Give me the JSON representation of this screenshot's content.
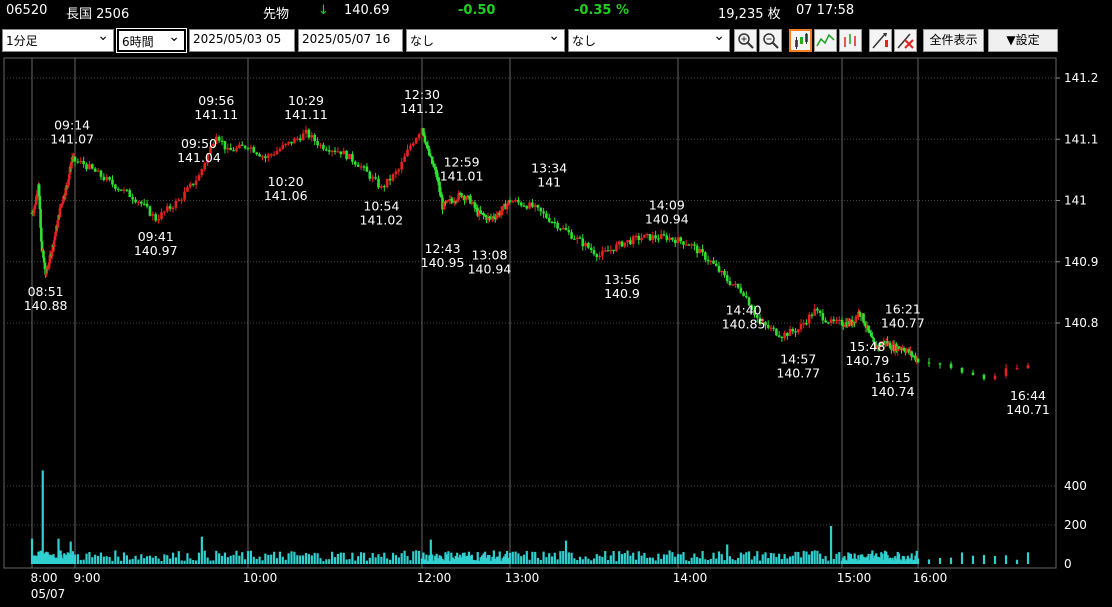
{
  "header": {
    "code": "06520",
    "name": "長国 2506",
    "type": "先物",
    "arrow": "↓",
    "price": "140.69",
    "change": "-0.50",
    "change_pct": "-0.35 %",
    "volume": "19,235 枚",
    "time": "07 17:58"
  },
  "toolbar": {
    "interval": "1分足",
    "span": "6時間",
    "from": "2025/05/03 05",
    "to": "2025/05/07 16",
    "indicator1": "なし",
    "indicator2": "なし",
    "zoom_in_icon": "zoom-in-icon",
    "zoom_out_icon": "zoom-out-icon",
    "candle_icon": "candlestick-icon",
    "line_icon": "line-chart-icon",
    "bar_icon": "ohlc-bar-icon",
    "draw_icon1": "draw-tool-icon",
    "draw_icon2": "draw-tool-erase-icon",
    "show_all": "全件表示",
    "settings": "▼設定"
  },
  "colors": {
    "up": "#e82020",
    "down": "#30e030",
    "volume": "#30d0d0",
    "grid": "#555555"
  },
  "chart_data": {
    "type": "candlestick",
    "price_axis": {
      "ticks": [
        "141.2",
        "141.1",
        "141",
        "140.9",
        "140.8"
      ],
      "ylim": [
        140.65,
        141.23
      ]
    },
    "volume_axis": {
      "ticks": [
        "400",
        "200",
        "0"
      ],
      "ylim": [
        0,
        480
      ]
    },
    "time_axis": {
      "ticks": [
        {
          "label": "8:00",
          "minute": 0
        },
        {
          "label": "9:00",
          "minute": 60
        },
        {
          "label": "10:00",
          "minute": 120
        },
        {
          "label": "12:00",
          "minute": 180
        },
        {
          "label": "13:00",
          "minute": 240
        },
        {
          "label": "14:00",
          "minute": 300
        },
        {
          "label": "15:00",
          "minute": 360
        },
        {
          "label": "16:00",
          "minute": 420
        }
      ],
      "date_label": "05/07"
    },
    "price_path": [
      [
        0,
        140.98
      ],
      [
        4,
        140.99
      ],
      [
        9,
        141.03
      ],
      [
        13,
        140.93
      ],
      [
        19,
        140.88
      ],
      [
        24,
        140.9
      ],
      [
        30,
        140.93
      ],
      [
        40,
        140.99
      ],
      [
        50,
        141.03
      ],
      [
        56,
        141.07
      ],
      [
        63,
        141.06
      ],
      [
        72,
        141.03
      ],
      [
        82,
        141.0
      ],
      [
        88,
        140.97
      ],
      [
        96,
        141.0
      ],
      [
        103,
        141.04
      ],
      [
        109,
        141.11
      ],
      [
        113,
        141.08
      ],
      [
        120,
        141.09
      ],
      [
        126,
        141.07
      ],
      [
        133,
        141.09
      ],
      [
        140,
        141.11
      ],
      [
        145,
        141.09
      ],
      [
        152,
        141.08
      ],
      [
        158,
        141.06
      ],
      [
        166,
        141.02
      ],
      [
        172,
        141.05
      ],
      [
        176,
        141.09
      ],
      [
        180,
        141.12
      ],
      [
        184,
        141.08
      ],
      [
        190,
        141.04
      ],
      [
        194,
        140.99
      ],
      [
        200,
        141.0
      ],
      [
        207,
        141.01
      ],
      [
        213,
        141.0
      ],
      [
        218,
        140.98
      ],
      [
        226,
        140.97
      ],
      [
        233,
        140.98
      ],
      [
        240,
        141.0
      ],
      [
        248,
        140.99
      ],
      [
        254,
        140.97
      ],
      [
        260,
        140.95
      ],
      [
        266,
        140.93
      ],
      [
        272,
        140.91
      ],
      [
        280,
        140.93
      ],
      [
        287,
        140.94
      ],
      [
        296,
        140.94
      ],
      [
        304,
        140.93
      ],
      [
        312,
        140.9
      ],
      [
        318,
        140.87
      ],
      [
        324,
        140.85
      ],
      [
        330,
        140.8
      ],
      [
        338,
        140.78
      ],
      [
        344,
        140.79
      ],
      [
        350,
        140.82
      ],
      [
        356,
        140.8
      ],
      [
        362,
        140.8
      ],
      [
        368,
        140.8
      ],
      [
        374,
        140.82
      ],
      [
        380,
        140.79
      ],
      [
        386,
        140.76
      ],
      [
        394,
        140.77
      ],
      [
        400,
        140.76
      ],
      [
        408,
        140.76
      ],
      [
        414,
        140.75
      ],
      [
        420,
        140.74
      ],
      [
        426,
        140.71
      ],
      [
        430,
        140.73
      ]
    ],
    "volume": [
      [
        0,
        130
      ],
      [
        15,
        480
      ],
      [
        18,
        45
      ],
      [
        22,
        60
      ],
      [
        27,
        40
      ],
      [
        37,
        130
      ],
      [
        42,
        30
      ],
      [
        45,
        55
      ],
      [
        54,
        115
      ],
      [
        58,
        45
      ],
      [
        66,
        35
      ],
      [
        75,
        38
      ],
      [
        92,
        45
      ],
      [
        104,
        140
      ],
      [
        110,
        55
      ],
      [
        130,
        30
      ],
      [
        178,
        70
      ],
      [
        186,
        125
      ],
      [
        192,
        45
      ],
      [
        200,
        58
      ],
      [
        210,
        40
      ],
      [
        224,
        32
      ],
      [
        260,
        120
      ],
      [
        272,
        42
      ],
      [
        296,
        48
      ],
      [
        318,
        100
      ],
      [
        332,
        60
      ],
      [
        350,
        70
      ],
      [
        356,
        195
      ],
      [
        358,
        52
      ],
      [
        400,
        32
      ],
      [
        420,
        28
      ],
      [
        430,
        60
      ]
    ],
    "annotations": [
      {
        "time": "08:51",
        "price": "140.88",
        "minute": 19,
        "pos": "below"
      },
      {
        "time": "09:14",
        "price": "141.07",
        "minute": 56,
        "pos": "above"
      },
      {
        "time": "09:41",
        "price": "140.97",
        "minute": 88,
        "pos": "below"
      },
      {
        "time": "09:50",
        "price": "141.04",
        "minute": 103,
        "pos": "above"
      },
      {
        "time": "09:56",
        "price": "141.11",
        "minute": 109,
        "pos": "above"
      },
      {
        "time": "10:20",
        "price": "141.06",
        "minute": 133,
        "pos": "below"
      },
      {
        "time": "10:29",
        "price": "141.11",
        "minute": 140,
        "pos": "above"
      },
      {
        "time": "10:54",
        "price": "141.02",
        "minute": 166,
        "pos": "below"
      },
      {
        "time": "12:30",
        "price": "141.12",
        "minute": 180,
        "pos": "above"
      },
      {
        "time": "12:43",
        "price": "140.95",
        "minute": 194,
        "pos": "below"
      },
      {
        "time": "12:59",
        "price": "141.01",
        "minute": 207,
        "pos": "above"
      },
      {
        "time": "13:08",
        "price": "140.94",
        "minute": 226,
        "pos": "below"
      },
      {
        "time": "13:34",
        "price": "141",
        "minute": 254,
        "pos": "above"
      },
      {
        "time": "13:56",
        "price": "140.9",
        "minute": 280,
        "pos": "below"
      },
      {
        "time": "14:09",
        "price": "140.94",
        "minute": 296,
        "pos": "above"
      },
      {
        "time": "14:40",
        "price": "140.85",
        "minute": 324,
        "pos": "below"
      },
      {
        "time": "14:57",
        "price": "140.77",
        "minute": 344,
        "pos": "below"
      },
      {
        "time": "15:48",
        "price": "140.79",
        "minute": 380,
        "pos": "below"
      },
      {
        "time": "16:15",
        "price": "140.74",
        "minute": 400,
        "pos": "below"
      },
      {
        "time": "16:21",
        "price": "140.77",
        "minute": 408,
        "pos": "above"
      },
      {
        "time": "16:44",
        "price": "140.71",
        "minute": 430,
        "pos": "below"
      }
    ]
  }
}
